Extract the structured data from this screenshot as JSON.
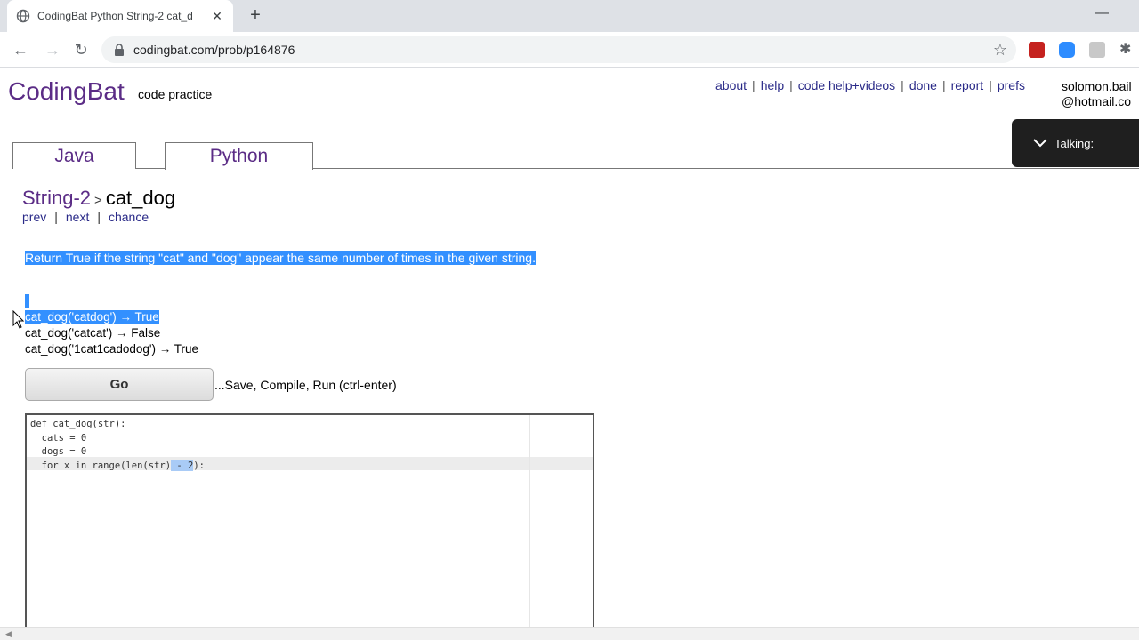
{
  "browser": {
    "tab_title": "CodingBat Python String-2 cat_d",
    "url": "codingbat.com/prob/p164876"
  },
  "site": {
    "logo": "CodingBat",
    "tagline": "code practice",
    "links": [
      "about",
      "help",
      "code help+videos",
      "done",
      "report",
      "prefs"
    ],
    "user_line1": "solomon.bail",
    "user_line2": "@hotmail.co"
  },
  "talking_widget": {
    "label": "Talking:"
  },
  "lang_tabs": [
    "Java",
    "Python"
  ],
  "problem": {
    "section": "String-2",
    "name": "cat_dog",
    "nav": [
      "prev",
      "next",
      "chance"
    ],
    "description": "Return True if the string \"cat\" and \"dog\" appear the same number of times in the given string.",
    "examples": [
      "cat_dog('catdog') → True",
      "cat_dog('catcat') → False",
      "cat_dog('1cat1cadodog') → True"
    ]
  },
  "go_button": {
    "label": "Go",
    "hint": "...Save, Compile, Run (ctrl-enter)"
  },
  "code": {
    "line1": "def cat_dog(str):",
    "line2": "  cats = 0",
    "line3": "  dogs = 0",
    "line4_pre": "  for x in range(len(str)",
    "line4_sel": " - 2",
    "line4_post": "):"
  }
}
